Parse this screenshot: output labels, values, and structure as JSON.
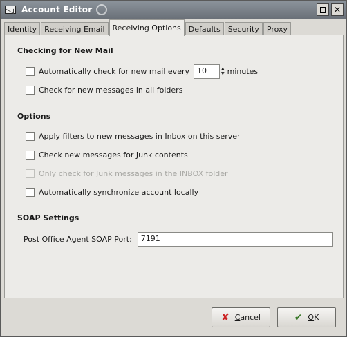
{
  "window": {
    "title": "Account Editor",
    "title_icon": "mail-icon",
    "buttons": [
      "restore",
      "close"
    ]
  },
  "tabs": [
    {
      "label": "Identity",
      "active": false
    },
    {
      "label": "Receiving Email",
      "active": false
    },
    {
      "label": "Receiving Options",
      "active": true
    },
    {
      "label": "Defaults",
      "active": false
    },
    {
      "label": "Security",
      "active": false
    },
    {
      "label": "Proxy",
      "active": false
    }
  ],
  "checking": {
    "title": "Checking for New Mail",
    "auto_check_pre": "Automatically check for ",
    "auto_check_n": "n",
    "auto_check_post": "ew mail every",
    "interval_value": "10",
    "interval_unit": "minutes",
    "all_folders": "Check for new messages in all folders"
  },
  "options": {
    "title": "Options",
    "apply_filters": "Apply filters to new messages in Inbox on this server",
    "junk_check": "Check new messages for Junk contents",
    "junk_inbox_only": "Only check for Junk messages in the INBOX folder",
    "sync_locally": "Automatically synchronize account locally"
  },
  "soap": {
    "title": "SOAP Settings",
    "port_label": "Post Office Agent SOAP Port:",
    "port_value": "7191"
  },
  "buttons": {
    "cancel": "Cancel",
    "cancel_mnemonic": "C",
    "cancel_rest": "ancel",
    "ok_mnemonic": "O",
    "ok_rest": "K"
  }
}
